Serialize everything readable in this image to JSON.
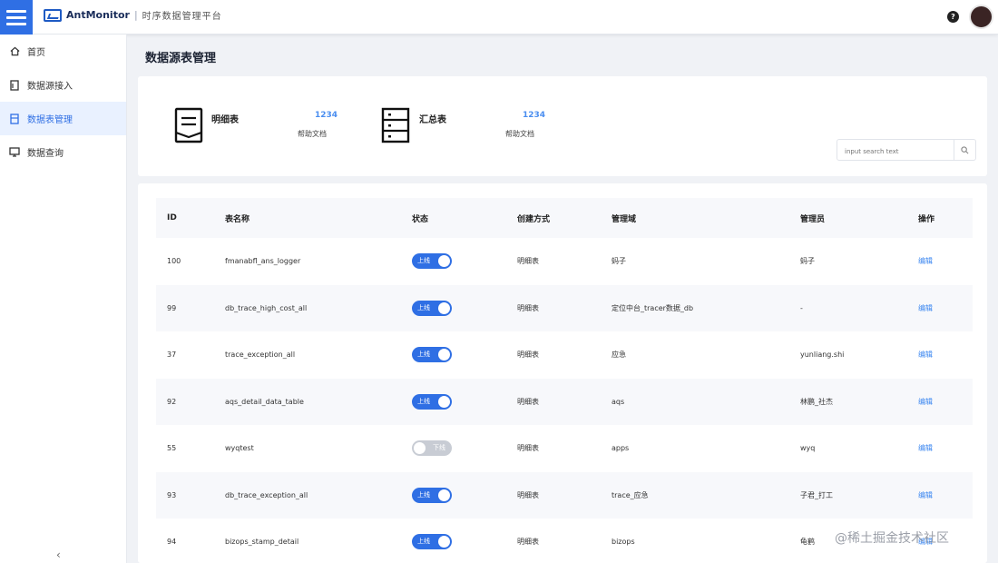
{
  "header": {
    "app_name": "AntMonitor",
    "separator": "|",
    "subtitle": "时序数据管理平台"
  },
  "sidebar": {
    "items": [
      {
        "label": "首页",
        "icon": "home-icon",
        "active": false
      },
      {
        "label": "数据源接入",
        "icon": "doc-icon",
        "active": false
      },
      {
        "label": "数据表管理",
        "icon": "table-icon",
        "active": true
      },
      {
        "label": "数据查询",
        "icon": "monitor-icon",
        "active": false
      }
    ],
    "collapse_label": "‹"
  },
  "main": {
    "page_title": "数据源表管理",
    "summary": [
      {
        "label": "明细表",
        "value": "1234",
        "link": "帮助文档",
        "icon": "document-list-icon"
      },
      {
        "label": "汇总表",
        "value": "1234",
        "link": "帮助文档",
        "icon": "server-rack-icon"
      }
    ],
    "search": {
      "placeholder": "input search text"
    },
    "table": {
      "columns": [
        "ID",
        "表名称",
        "状态",
        "创建方式",
        "管理域",
        "管理员",
        "操作"
      ],
      "rows": [
        {
          "id": "100",
          "name": "fmanabfl_ans_logger",
          "status": "上线",
          "on": true,
          "method": "明细表",
          "domain": "蚂子",
          "owner": "蚂子",
          "op": "编辑"
        },
        {
          "id": "99",
          "name": "db_trace_high_cost_all",
          "status": "上线",
          "on": true,
          "method": "明细表",
          "domain": "定位中台_tracer数据_db",
          "owner": "-",
          "op": "编辑"
        },
        {
          "id": "37",
          "name": "trace_exception_all",
          "status": "上线",
          "on": true,
          "method": "明细表",
          "domain": "应急",
          "owner": "yunliang.shi",
          "op": "编辑"
        },
        {
          "id": "92",
          "name": "aqs_detail_data_table",
          "status": "上线",
          "on": true,
          "method": "明细表",
          "domain": "aqs",
          "owner": "林鹏_社杰",
          "op": "编辑"
        },
        {
          "id": "55",
          "name": "wyqtest",
          "status": "下线",
          "on": false,
          "method": "明细表",
          "domain": "apps",
          "owner": "wyq",
          "op": "编辑"
        },
        {
          "id": "93",
          "name": "db_trace_exception_all",
          "status": "上线",
          "on": true,
          "method": "明细表",
          "domain": "trace_应急",
          "owner": "子君_打工",
          "op": "编辑"
        },
        {
          "id": "94",
          "name": "bizops_stamp_detail",
          "status": "上线",
          "on": true,
          "method": "明细表",
          "domain": "bizops",
          "owner": "龟鹤",
          "op": "编辑"
        }
      ]
    }
  },
  "watermark": "@稀土掘金技术社区",
  "colors": {
    "primary": "#2f6fe4",
    "link": "#3a86f0",
    "toggle_off": "#c8ccd4"
  }
}
